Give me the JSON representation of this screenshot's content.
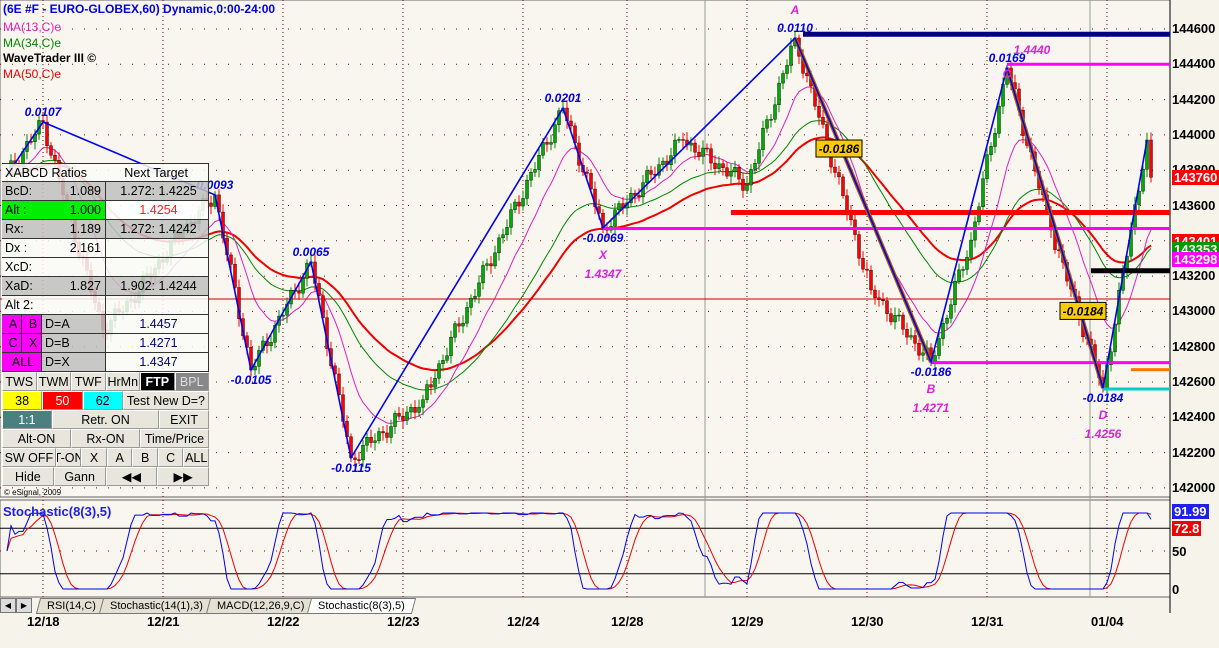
{
  "header": {
    "title": "(6E #F - EURO-GLOBEX,60) Dynamic,0:00-24:00",
    "studies": [
      "MA(13,C)e",
      "MA(34,C)e",
      "WaveTrader III ©",
      "MA(50,C)e"
    ],
    "copyright": "© eSignal, 2009"
  },
  "colors": {
    "up": "#008800",
    "down": "#ff0000",
    "ma13": "#e020c0",
    "ma34": "#008800",
    "ma50": "#ee0000",
    "zigzag": "#0000ee",
    "label_magenta": "#e020e0"
  },
  "chart_data": {
    "type": "candlestick",
    "title": "(6E #F - EURO-GLOBEX,60)",
    "ylim": [
      142000,
      144600
    ],
    "y_ticks": [
      144600,
      144400,
      144200,
      144000,
      143800,
      143600,
      143400,
      143200,
      143000,
      142800,
      142600,
      142400,
      142200,
      142000
    ],
    "x_ticks": [
      {
        "label": "12/18",
        "bar": 9
      },
      {
        "label": "12/21",
        "bar": 39
      },
      {
        "label": "12/22",
        "bar": 69
      },
      {
        "label": "12/23",
        "bar": 99
      },
      {
        "label": "12/24",
        "bar": 129
      },
      {
        "label": "12/28",
        "bar": 155
      },
      {
        "label": "12/29",
        "bar": 185
      },
      {
        "label": "12/30",
        "bar": 215
      },
      {
        "label": "12/31",
        "bar": 245
      },
      {
        "label": "01/04",
        "bar": 275
      }
    ],
    "bars": 287,
    "pivots": [
      [
        0,
        143773
      ],
      [
        9,
        144073
      ],
      [
        14,
        143660
      ],
      [
        24,
        142895
      ],
      [
        31,
        143065
      ],
      [
        44,
        143460
      ],
      [
        52,
        143660
      ],
      [
        61,
        142668
      ],
      [
        76,
        143280
      ],
      [
        86,
        142170
      ],
      [
        104,
        142500
      ],
      [
        139,
        144152
      ],
      [
        149,
        143473
      ],
      [
        169,
        143971
      ],
      [
        185,
        143716
      ],
      [
        197,
        144549
      ],
      [
        216,
        143121
      ],
      [
        231,
        142713
      ],
      [
        241,
        143404
      ],
      [
        250,
        144379
      ],
      [
        261,
        143461
      ],
      [
        274,
        142566
      ],
      [
        285,
        143971
      ],
      [
        286,
        143760
      ]
    ],
    "zigzag_bars": [
      0,
      9,
      52,
      61,
      76,
      86,
      139,
      149,
      197,
      231,
      250,
      274,
      285
    ],
    "wave_labels": [
      {
        "bar": 9,
        "text": "0.0107",
        "pos": "above"
      },
      {
        "bar": 52,
        "text": "0.0093",
        "pos": "above"
      },
      {
        "bar": 61,
        "text": "-0.0105",
        "pos": "below"
      },
      {
        "bar": 76,
        "text": "0.0065",
        "pos": "above"
      },
      {
        "bar": 86,
        "text": "-0.0115",
        "pos": "below"
      },
      {
        "bar": 139,
        "text": "0.0201",
        "pos": "above"
      },
      {
        "bar": 149,
        "text": "-0.0069",
        "pos": "below"
      },
      {
        "bar": 197,
        "text": "0.0110",
        "pos": "above"
      },
      {
        "bar": 231,
        "text": "-0.0186",
        "pos": "below"
      },
      {
        "bar": 250,
        "text": "0.0169",
        "pos": "above"
      },
      {
        "bar": 274,
        "text": "-0.0184",
        "pos": "below"
      }
    ],
    "pattern_points": [
      {
        "letter": "X",
        "price": "1.4347",
        "bar": 149
      },
      {
        "letter": "A",
        "price": "",
        "bar": 197
      },
      {
        "letter": "B",
        "price": "1.4271",
        "bar": 231
      },
      {
        "letter": "C",
        "price": "1.4440",
        "bar": 250
      },
      {
        "letter": "D",
        "price": "1.4256",
        "bar": 274
      }
    ],
    "retrace_boxes": [
      {
        "text": "-0.0186",
        "bar": 208,
        "price": 143920
      },
      {
        "text": "-0.0184",
        "bar": 269,
        "price": 143000
      }
    ],
    "levels": [
      {
        "price": 144570,
        "from": 199,
        "color": "#000080"
      },
      {
        "price": 144400,
        "from": 250,
        "color": "#ff00ff"
      },
      {
        "price": 143560,
        "from": 181,
        "color": "#ff0000"
      },
      {
        "price": 143470,
        "from": 149,
        "color": "#ff00ff"
      },
      {
        "price": 143230,
        "from": 271,
        "color": "#000000"
      },
      {
        "price": 142710,
        "from": 231,
        "color": "#ff00ff"
      },
      {
        "price": 142670,
        "from": 281,
        "color": "#ff7700"
      },
      {
        "price": 142560,
        "from": 274,
        "color": "#00cccc"
      }
    ],
    "thin_level": 143070,
    "price_tags": [
      {
        "text": "143760",
        "price": 143760,
        "bg": "#ff0000"
      },
      {
        "text": "143401",
        "price": 143401,
        "bg": "#ff0000"
      },
      {
        "text": "143353",
        "price": 143353,
        "bg": "#009900"
      },
      {
        "text": "143298",
        "price": 143298,
        "bg": "#ff00ff"
      }
    ],
    "stochastic": {
      "title": "Stochastic(8(3),5)",
      "ylim": [
        0,
        100
      ],
      "ticks": [
        "50",
        "0"
      ],
      "k_value": "91.99",
      "d_value": "72.8",
      "levels": [
        80,
        20
      ]
    }
  },
  "panel": {
    "header": [
      "XABCD Ratios",
      "Next Target"
    ],
    "rows": [
      [
        "BcD:",
        "1.089",
        "1.272: 1.4225",
        "g"
      ],
      [
        "Alt  :",
        "1.000",
        "1.4254",
        "alt"
      ],
      [
        "Rx:",
        "1.189",
        "1.272: 1.4242",
        "g"
      ],
      [
        "Dx  :",
        "2.161",
        "",
        "w"
      ],
      [
        "XcD:",
        "",
        "",
        "w"
      ],
      [
        "XaD:",
        "1.827",
        "1.902: 1.4244",
        "g"
      ],
      [
        "Alt 2:",
        "",
        "",
        "w"
      ]
    ],
    "targets": [
      [
        "A",
        "B",
        "D=A",
        "1.4457"
      ],
      [
        "C",
        "X",
        "D=B",
        "1.4271"
      ],
      [
        "ALL",
        "",
        "D=X",
        "1.4347"
      ]
    ],
    "buttons": [
      [
        "TWS",
        "TWM",
        "TWF",
        "HrMn",
        "FTP",
        "BPL"
      ],
      [
        "38",
        "50",
        "62",
        "Test New D=?"
      ],
      [
        "1:1",
        "Retr. ON",
        "EXIT"
      ],
      [
        "Alt-ON",
        "Rx-ON",
        "Time/Price"
      ],
      [
        "SW OFF",
        "T-ON",
        "X",
        "A",
        "B",
        "C",
        "ALL"
      ],
      [
        "Hide",
        "Gann",
        "◀◀",
        "▶▶"
      ]
    ]
  },
  "tabs": [
    "RSI(14,C)",
    "Stochastic(14(1),3)",
    "MACD(12,26,9,C)",
    "Stochastic(8(3),5)"
  ]
}
